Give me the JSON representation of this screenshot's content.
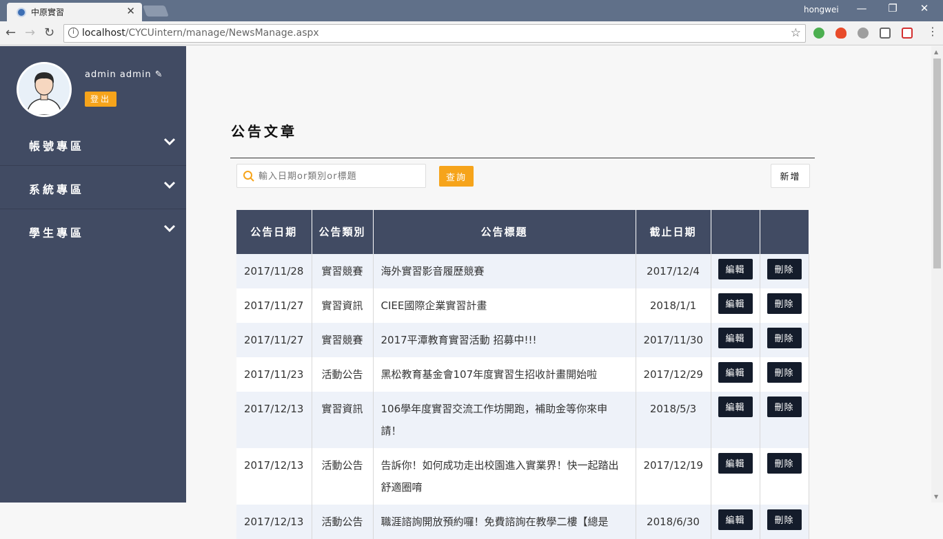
{
  "browser": {
    "tab_title": "中原實習",
    "tab_close": "✕",
    "user": "hongwei",
    "url_host": "localhost",
    "url_path": "/CYCUintern/manage/NewsManage.aspx",
    "win_min": "—",
    "win_restore": "❐",
    "win_close": "✕",
    "nav_back": "←",
    "nav_forward": "→",
    "nav_reload": "↻",
    "info_glyph": "i",
    "star_glyph": "☆"
  },
  "sidebar": {
    "profile_name": "admin admin",
    "edit_glyph": "✎",
    "logout_label": "登出",
    "items": [
      {
        "label": "帳號專區"
      },
      {
        "label": "系統專區"
      },
      {
        "label": "學生專區"
      }
    ]
  },
  "main": {
    "title": "公告文章",
    "search_placeholder": "輸入日期or類別or標題",
    "query_label": "查詢",
    "add_label": "新增",
    "table": {
      "headers": [
        "公告日期",
        "公告類別",
        "公告標題",
        "截止日期",
        "",
        ""
      ],
      "rows": [
        {
          "date": "2017/11/28",
          "category": "實習競賽",
          "title": "海外實習影音履歷競賽",
          "deadline": "2017/12/4"
        },
        {
          "date": "2017/11/27",
          "category": "實習資訊",
          "title": "CIEE國際企業實習計畫",
          "deadline": "2018/1/1"
        },
        {
          "date": "2017/11/27",
          "category": "實習競賽",
          "title": "2017平潭教育實習活動 招募中!!!",
          "deadline": "2017/11/30"
        },
        {
          "date": "2017/11/23",
          "category": "活動公告",
          "title": "黑松教育基金會107年度實習生招收計畫開始啦",
          "deadline": "2017/12/29"
        },
        {
          "date": "2017/12/13",
          "category": "實習資訊",
          "title": "106學年度實習交流工作坊開跑，補助金等你來申請！",
          "deadline": "2018/5/3"
        },
        {
          "date": "2017/12/13",
          "category": "活動公告",
          "title": "告訴你！如何成功走出校園進入實業界！快一起踏出舒適圈唷",
          "deadline": "2017/12/19"
        },
        {
          "date": "2017/12/13",
          "category": "活動公告",
          "title": "職涯諮詢開放預約囉！免費諮詢在教學二樓【總是",
          "deadline": "2018/6/30"
        }
      ],
      "edit_label": "編輯",
      "delete_label": "刪除"
    }
  },
  "colors": {
    "sidebar_bg": "#414b63",
    "accent": "#f6a41b",
    "row_button": "#141c2b"
  }
}
